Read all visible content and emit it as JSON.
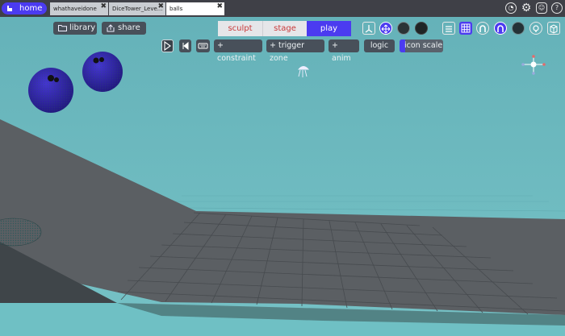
{
  "tabs": [
    {
      "label": "home",
      "active": false,
      "home": true
    },
    {
      "label": "whathaveidone",
      "active": false
    },
    {
      "label": "DiceTower_Leve...",
      "active": false
    },
    {
      "label": "balls",
      "active": true
    }
  ],
  "top_right_icons": [
    "gauge-icon",
    "gear-icon",
    "discord-icon",
    "help-icon"
  ],
  "toolbar": {
    "library_label": "library",
    "share_label": "share",
    "modes": [
      {
        "label": "sculpt",
        "selected": false
      },
      {
        "label": "stage",
        "selected": false
      },
      {
        "label": "play",
        "selected": true
      }
    ],
    "right_tools": [
      "transform-gizmo-icon",
      "move-icon",
      "material-ball-dark-icon",
      "material-ball-black-icon",
      "list-icon",
      "grid-icon",
      "magnet-icon",
      "snap-arc-icon",
      "texture-ball-icon",
      "lightbulb-icon",
      "cube-icon"
    ]
  },
  "row2": {
    "constraint_label": "+ constraint",
    "trigger_label": "+ trigger zone",
    "anim_label": "+ anim",
    "logic_label": "logic",
    "icon_scale_label": "icon scale"
  },
  "colors": {
    "accent": "#4b3bf0",
    "sky": "#6bb8be",
    "ground": "#5a5e62",
    "ball": "#2f23a8",
    "button": "#48505a"
  }
}
